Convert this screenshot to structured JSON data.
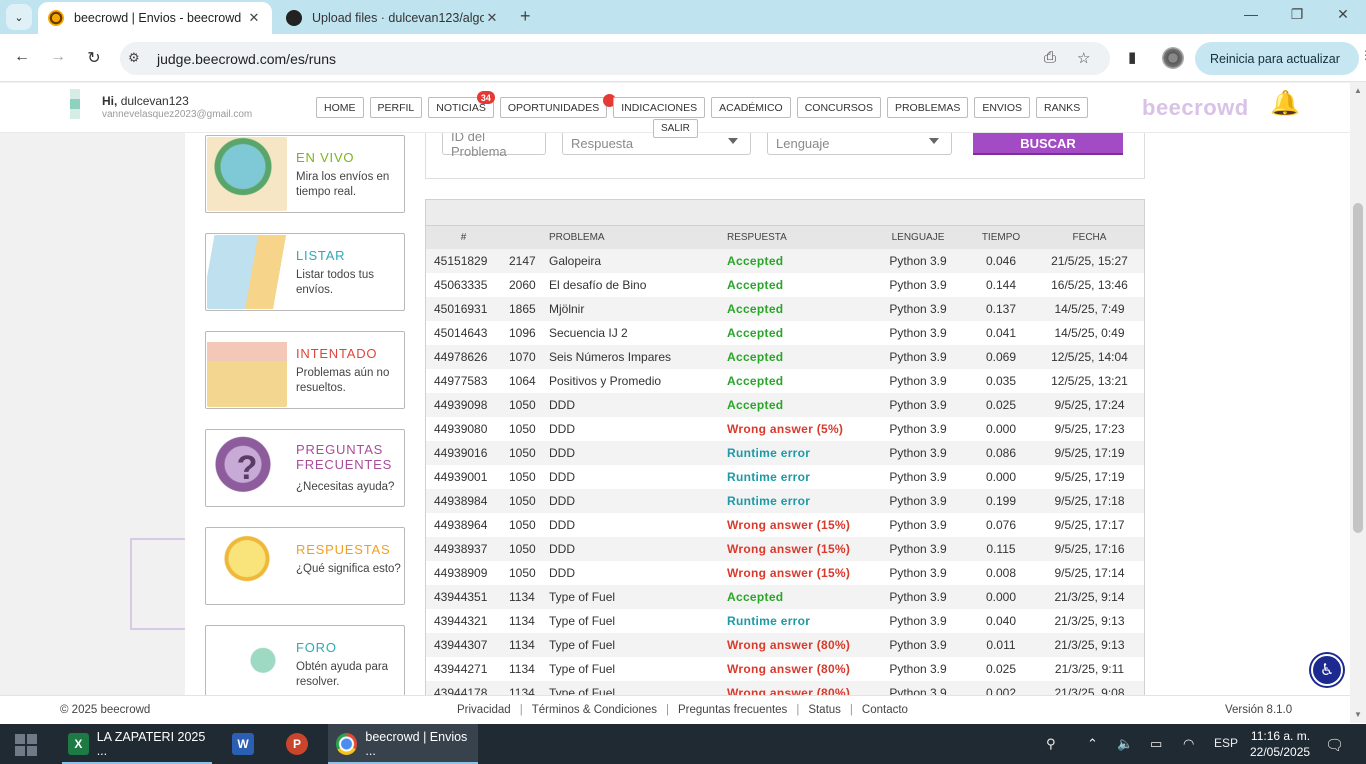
{
  "browser": {
    "tabs": [
      {
        "title": "beecrowd | Envios - beecrowd",
        "active": true
      },
      {
        "title": "Upload files · dulcevan123/algo",
        "active": false
      }
    ],
    "url": "judge.beecrowd.com/es/runs",
    "update_label": "Reinicia para actualizar"
  },
  "header": {
    "greeting_prefix": "Hi,",
    "username": "dulcevan123",
    "email": "vannevelasquez2023@gmail.com",
    "nav": [
      "HOME",
      "PERFIL",
      "NOTICIAS",
      "OPORTUNIDADES",
      "INDICACIONES",
      "ACADÉMICO",
      "CONCURSOS",
      "PROBLEMAS",
      "ENVIOS",
      "RANKS"
    ],
    "noticias_badge": "34",
    "salir": "SALIR",
    "logo": "beecrowd"
  },
  "sidebar": {
    "cards": [
      {
        "title": "EN VIVO",
        "desc": "Mira los envíos en tiempo real.",
        "color": "#7cb518"
      },
      {
        "title": "LISTAR",
        "desc": "Listar todos tus envíos.",
        "color": "#2fa8b8"
      },
      {
        "title": "INTENTADO",
        "desc": "Problemas aún no resueltos.",
        "color": "#e0453a"
      },
      {
        "title": "PREGUNTAS FRECUENTES",
        "desc": "¿Necesitas ayuda?",
        "color": "#a84d9a"
      },
      {
        "title": "RESPUESTAS",
        "desc": "¿Qué significa esto?",
        "color": "#f0a020"
      },
      {
        "title": "FORO",
        "desc": "Obtén ayuda para resolver.",
        "color": "#2fa8b8"
      }
    ]
  },
  "search": {
    "problem_id_placeholder": "ID del Problema",
    "answer_placeholder": "Respuesta",
    "language_placeholder": "Lenguaje",
    "button": "BUSCAR"
  },
  "table": {
    "headers": {
      "id": "#",
      "problem": "PROBLEMA",
      "answer": "RESPUESTA",
      "language": "LENGUAJE",
      "time": "TIEMPO",
      "date": "FECHA"
    },
    "rows": [
      {
        "id": "45151829",
        "pid": "2147",
        "problem": "Galopeira",
        "answer": "Accepted",
        "status": "acc",
        "lang": "Python 3.9",
        "time": "0.046",
        "date": "21/5/25, 15:27"
      },
      {
        "id": "45063335",
        "pid": "2060",
        "problem": "El desafío de Bino",
        "answer": "Accepted",
        "status": "acc",
        "lang": "Python 3.9",
        "time": "0.144",
        "date": "16/5/25, 13:46"
      },
      {
        "id": "45016931",
        "pid": "1865",
        "problem": "Mjölnir",
        "answer": "Accepted",
        "status": "acc",
        "lang": "Python 3.9",
        "time": "0.137",
        "date": "14/5/25, 7:49"
      },
      {
        "id": "45014643",
        "pid": "1096",
        "problem": "Secuencia IJ 2",
        "answer": "Accepted",
        "status": "acc",
        "lang": "Python 3.9",
        "time": "0.041",
        "date": "14/5/25, 0:49"
      },
      {
        "id": "44978626",
        "pid": "1070",
        "problem": "Seis Números Impares",
        "answer": "Accepted",
        "status": "acc",
        "lang": "Python 3.9",
        "time": "0.069",
        "date": "12/5/25, 14:04"
      },
      {
        "id": "44977583",
        "pid": "1064",
        "problem": "Positivos y Promedio",
        "answer": "Accepted",
        "status": "acc",
        "lang": "Python 3.9",
        "time": "0.035",
        "date": "12/5/25, 13:21"
      },
      {
        "id": "44939098",
        "pid": "1050",
        "problem": "DDD",
        "answer": "Accepted",
        "status": "acc",
        "lang": "Python 3.9",
        "time": "0.025",
        "date": "9/5/25, 17:24"
      },
      {
        "id": "44939080",
        "pid": "1050",
        "problem": "DDD",
        "answer": "Wrong answer (5%)",
        "status": "wa",
        "lang": "Python 3.9",
        "time": "0.000",
        "date": "9/5/25, 17:23"
      },
      {
        "id": "44939016",
        "pid": "1050",
        "problem": "DDD",
        "answer": "Runtime error",
        "status": "re",
        "lang": "Python 3.9",
        "time": "0.086",
        "date": "9/5/25, 17:19"
      },
      {
        "id": "44939001",
        "pid": "1050",
        "problem": "DDD",
        "answer": "Runtime error",
        "status": "re",
        "lang": "Python 3.9",
        "time": "0.000",
        "date": "9/5/25, 17:19"
      },
      {
        "id": "44938984",
        "pid": "1050",
        "problem": "DDD",
        "answer": "Runtime error",
        "status": "re",
        "lang": "Python 3.9",
        "time": "0.199",
        "date": "9/5/25, 17:18"
      },
      {
        "id": "44938964",
        "pid": "1050",
        "problem": "DDD",
        "answer": "Wrong answer (15%)",
        "status": "wa",
        "lang": "Python 3.9",
        "time": "0.076",
        "date": "9/5/25, 17:17"
      },
      {
        "id": "44938937",
        "pid": "1050",
        "problem": "DDD",
        "answer": "Wrong answer (15%)",
        "status": "wa",
        "lang": "Python 3.9",
        "time": "0.115",
        "date": "9/5/25, 17:16"
      },
      {
        "id": "44938909",
        "pid": "1050",
        "problem": "DDD",
        "answer": "Wrong answer (15%)",
        "status": "wa",
        "lang": "Python 3.9",
        "time": "0.008",
        "date": "9/5/25, 17:14"
      },
      {
        "id": "43944351",
        "pid": "1134",
        "problem": "Type of Fuel",
        "answer": "Accepted",
        "status": "acc",
        "lang": "Python 3.9",
        "time": "0.000",
        "date": "21/3/25, 9:14"
      },
      {
        "id": "43944321",
        "pid": "1134",
        "problem": "Type of Fuel",
        "answer": "Runtime error",
        "status": "re",
        "lang": "Python 3.9",
        "time": "0.040",
        "date": "21/3/25, 9:13"
      },
      {
        "id": "43944307",
        "pid": "1134",
        "problem": "Type of Fuel",
        "answer": "Wrong answer (80%)",
        "status": "wa",
        "lang": "Python 3.9",
        "time": "0.011",
        "date": "21/3/25, 9:13"
      },
      {
        "id": "43944271",
        "pid": "1134",
        "problem": "Type of Fuel",
        "answer": "Wrong answer (80%)",
        "status": "wa",
        "lang": "Python 3.9",
        "time": "0.025",
        "date": "21/3/25, 9:11"
      },
      {
        "id": "43944178",
        "pid": "1134",
        "problem": "Type of Fuel",
        "answer": "Wrong answer (80%)",
        "status": "wa",
        "lang": "Python 3.9",
        "time": "0.002",
        "date": "21/3/25, 9:08"
      }
    ]
  },
  "footer": {
    "copyright": "© 2025 beecrowd",
    "links": [
      "Privacidad",
      "Términos & Condiciones",
      "Preguntas frecuentes",
      "Status",
      "Contacto"
    ],
    "version": "Versión 8.1.0"
  },
  "taskbar": {
    "apps": [
      {
        "label": "LA ZAPATERI 2025 ...",
        "icon": "excel-icon",
        "color": "#1d7a45",
        "glyph": "X"
      },
      {
        "label": "",
        "icon": "word-icon",
        "color": "#2b5fb4",
        "glyph": "W"
      },
      {
        "label": "",
        "icon": "powerpoint-icon",
        "color": "#c9452b",
        "glyph": "P"
      },
      {
        "label": "beecrowd | Envios ...",
        "icon": "chrome-icon",
        "color": "#e8b400",
        "glyph": ""
      }
    ],
    "language": "ESP",
    "time": "11:16 a. m.",
    "date": "22/05/2025",
    "notifications": "1"
  }
}
